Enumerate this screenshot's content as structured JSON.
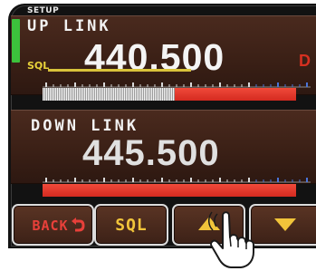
{
  "screen": {
    "title": "SETUP"
  },
  "uplink": {
    "label": "UP LINK",
    "frequency": "440.500",
    "sql_label": "SQL",
    "mode_tag": "D",
    "meter_level": 0.52
  },
  "downlink": {
    "label": "DOWN LINK",
    "frequency": "445.500",
    "meter_level": 0.0
  },
  "buttons": {
    "back": "BACK",
    "sql": "SQL",
    "up_icon": "triangle-up-icon",
    "down_icon": "triangle-down-icon"
  },
  "colors": {
    "accent_yellow": "#f1c43a",
    "alert_red": "#e8403a",
    "green": "#3cc23c",
    "display_bg": "#3b2016"
  }
}
